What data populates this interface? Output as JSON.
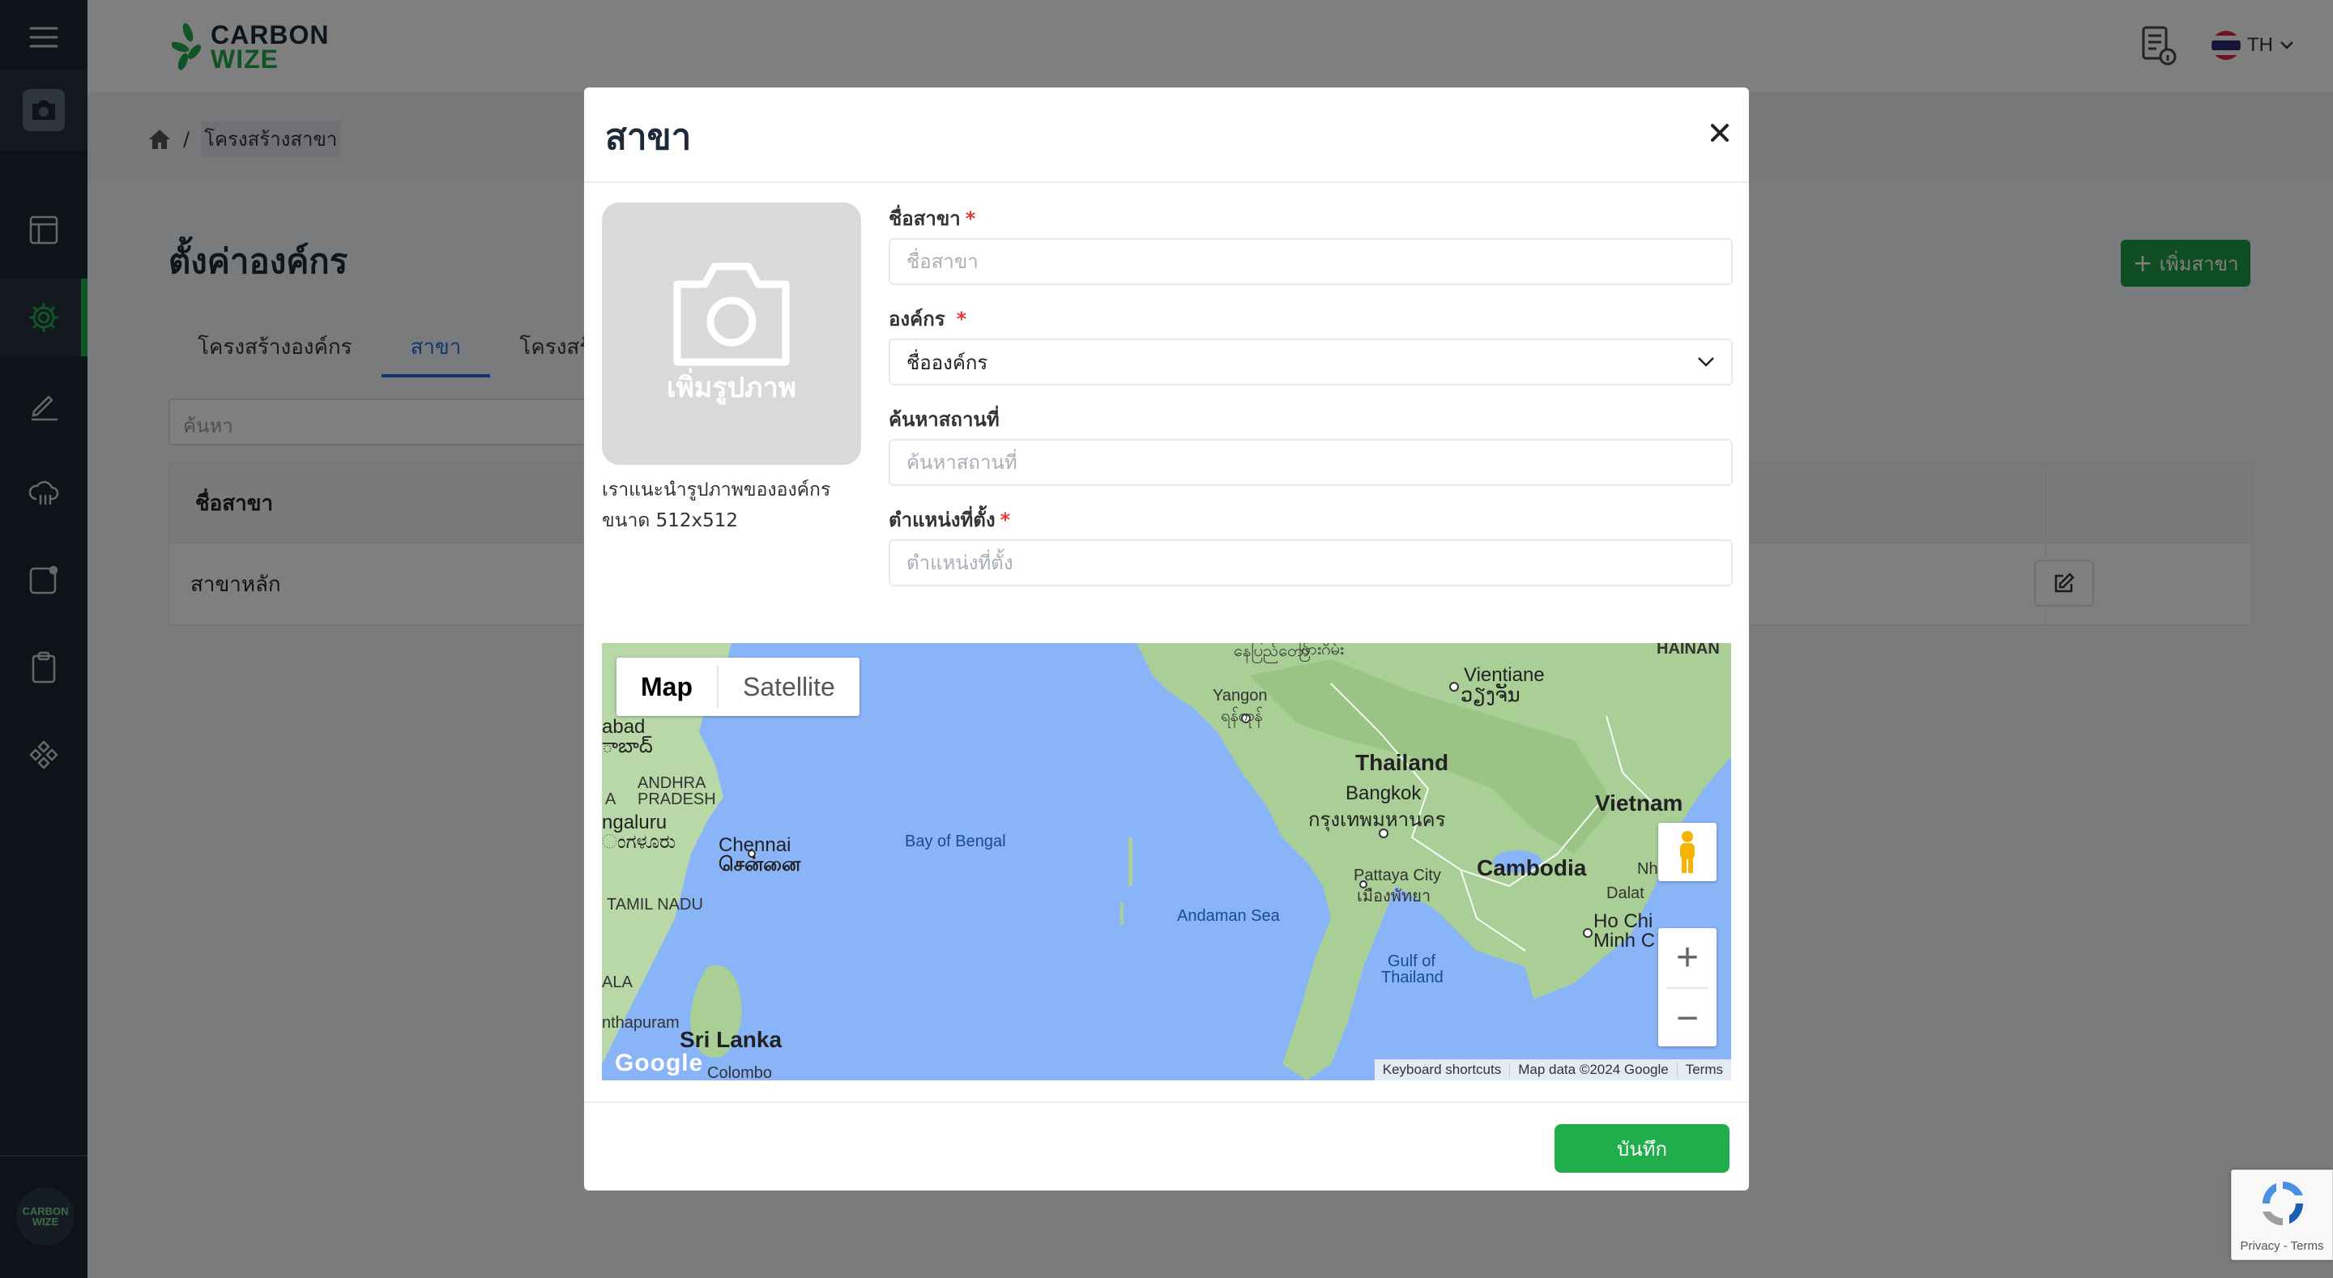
{
  "brand": {
    "line1": "CARBON",
    "line2": "WIZE"
  },
  "topbar": {
    "lang": "TH"
  },
  "breadcrumb": {
    "separator": "/",
    "current": "โครงสร้างสาขา"
  },
  "page": {
    "title": "ตั้งค่าองค์กร",
    "add_button": "เพิ่มสาขา",
    "tabs": [
      "โครงสร้างองค์กร",
      "สาขา",
      "โครงสร้าง"
    ],
    "search_placeholder": "ค้นหา",
    "table": {
      "header": "ชื่อสาขา",
      "rows": [
        "สาขาหลัก"
      ]
    }
  },
  "sidebar_logo": {
    "line1": "CARBON",
    "line2": "WIZE"
  },
  "modal": {
    "title": "สาขา",
    "photo_label": "เพิ่มรูปภาพ",
    "photo_hint_1": "เราแนะนำรูปภาพขององค์กร",
    "photo_hint_2": "ขนาด 512x512",
    "fields": {
      "branch_name": {
        "label": "ชื่อสาขา",
        "placeholder": "ชื่อสาขา"
      },
      "org": {
        "label": "องค์กร",
        "value": "ชื่อองค์กร"
      },
      "search_place": {
        "label": "ค้นหาสถานที่",
        "placeholder": "ค้นหาสถานที่"
      },
      "location": {
        "label": "ตำแหน่งที่ตั้ง",
        "placeholder": "ตำแหน่งที่ตั้ง"
      }
    },
    "required_mark": "*",
    "save_button": "บันทึก"
  },
  "map": {
    "toggle": {
      "map": "Map",
      "satellite": "Satellite"
    },
    "labels": {
      "thailand": "Thailand",
      "bangkok": "Bangkok",
      "bangkok_th": "กรุงเทพมหานคร",
      "vietnam": "Vietnam",
      "cambodia": "Cambodia",
      "vientiane": "Vientiane",
      "vientiane_lo": "ວຽງຈັນ",
      "yangon": "Yangon",
      "yangon_my": "ရန်ကုန်",
      "hainan": "HAINAN",
      "bay_of_bengal": "Bay of Bengal",
      "andaman_sea": "Andaman Sea",
      "gulf_of_thailand_1": "Gulf of",
      "gulf_of_thailand_2": "Thailand",
      "chennai": "Chennai",
      "chennai_ta": "சென்னை",
      "andhra": "ANDHRA",
      "pradesh": "PRADESH",
      "tamil_nadu": "TAMIL NADU",
      "sri_lanka": "Sri Lanka",
      "colombo": "Colombo",
      "bengaluru": "ngaluru",
      "bengaluru_kn": "ಂಗಳೂರು",
      "hyderabad": "abad",
      "hyderabad_te": "ాబాద్",
      "pattaya": "Pattaya City",
      "pattaya_th": "เมืองพัทยา",
      "ho_chi_minh_1": "Ho Chi",
      "ho_chi_minh_2": "Minh C",
      "dalat": "Dalat",
      "nha": "Nha",
      "thiruvananthapuram": "nthapuram",
      "kerala": "ALA",
      "a_label": "A",
      "naypyidaw": "နေပြည်တော်",
      "top_label": "ဖြားဂိမ်း"
    },
    "footer": {
      "shortcuts": "Keyboard shortcuts",
      "data": "Map data ©2024 Google",
      "terms": "Terms"
    },
    "google": "Google"
  },
  "recaptcha": {
    "links": "Privacy - Terms"
  }
}
